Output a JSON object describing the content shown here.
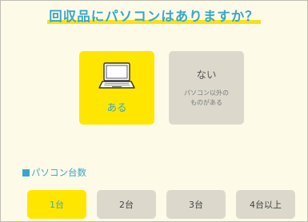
{
  "title": "回収品にパソコンはありますか？",
  "choices": {
    "yes": {
      "label": "ある",
      "icon": "laptop-icon"
    },
    "no": {
      "label": "ない",
      "sub_line1": "パソコン以外の",
      "sub_line2": "ものがある"
    }
  },
  "section": {
    "label": "パソコン台数"
  },
  "counts": [
    {
      "label": "1台",
      "selected": true
    },
    {
      "label": "2台",
      "selected": false
    },
    {
      "label": "3台",
      "selected": false
    },
    {
      "label": "4台以上",
      "selected": false
    }
  ],
  "colors": {
    "background": "#fdfbe8",
    "accent_blue": "#3aa6c8",
    "accent_yellow": "#ffe600",
    "inactive_gray": "#dcd9cc"
  }
}
